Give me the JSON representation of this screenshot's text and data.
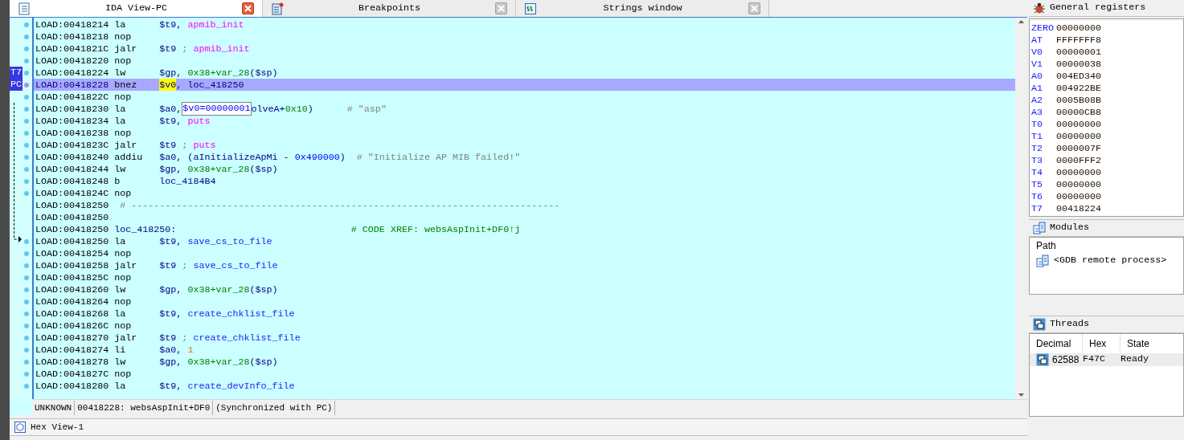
{
  "tabs": [
    {
      "label": "IDA View-PC",
      "selected": true,
      "kind": "disasm"
    },
    {
      "label": "Breakpoints",
      "selected": false,
      "kind": "breakpoints"
    },
    {
      "label": "Strings window",
      "selected": false,
      "kind": "strings"
    }
  ],
  "disassembly": {
    "lines": [
      {
        "address": "LOAD:00418214",
        "mnemonic": "la",
        "dot": true,
        "selected": false,
        "segments": [
          {
            "text": "$t9, ",
            "kind": "plain"
          },
          {
            "text": "apmib_init",
            "kind": "import"
          }
        ]
      },
      {
        "address": "LOAD:00418218",
        "mnemonic": "nop",
        "dot": true,
        "selected": false
      },
      {
        "address": "LOAD:0041821C",
        "mnemonic": "jalr",
        "dot": true,
        "selected": false,
        "segments": [
          {
            "text": "$t9 ",
            "kind": "plain"
          },
          {
            "text": "; ",
            "kind": "comment"
          },
          {
            "text": "apmib_init",
            "kind": "import"
          }
        ]
      },
      {
        "address": "LOAD:00418220",
        "mnemonic": "nop",
        "dot": true,
        "selected": false
      },
      {
        "address": "LOAD:00418224",
        "mnemonic": "lw",
        "dot": true,
        "selected": false,
        "gutter_label": "T7",
        "segments": [
          {
            "text": "$gp, ",
            "kind": "plain"
          },
          {
            "text": "0x38+var_28",
            "kind": "number"
          },
          {
            "text": "($sp)",
            "kind": "plain"
          }
        ]
      },
      {
        "address": "LOAD:00418228",
        "mnemonic": "bnez",
        "dot": true,
        "selected": true,
        "gutter_label": "PC",
        "segments": [
          {
            "text": "$v0",
            "kind": "highlight"
          },
          {
            "text": ", loc_418250",
            "kind": "plain"
          }
        ]
      },
      {
        "address": "LOAD:0041822C",
        "mnemonic": "nop",
        "dot": true,
        "selected": false
      },
      {
        "address": "LOAD:00418230",
        "mnemonic": "la",
        "dot": true,
        "selected": false,
        "segments": [
          {
            "text": "$a0,",
            "kind": "plain"
          },
          {
            "text": "$v0=00000001",
            "kind": "tooltip"
          },
          {
            "text": "olveA+",
            "kind": "plain"
          },
          {
            "text": "0x10",
            "kind": "number"
          },
          {
            "text": ")      ",
            "kind": "plain"
          },
          {
            "text": "# \"asp\"",
            "kind": "comment"
          }
        ]
      },
      {
        "address": "LOAD:00418234",
        "mnemonic": "la",
        "dot": true,
        "selected": false,
        "segments": [
          {
            "text": "$t9, ",
            "kind": "plain"
          },
          {
            "text": "puts",
            "kind": "import"
          }
        ]
      },
      {
        "address": "LOAD:00418238",
        "mnemonic": "nop",
        "dot": true,
        "selected": false
      },
      {
        "address": "LOAD:0041823C",
        "mnemonic": "jalr",
        "dot": true,
        "selected": false,
        "segments": [
          {
            "text": "$t9 ",
            "kind": "plain"
          },
          {
            "text": "; ",
            "kind": "comment"
          },
          {
            "text": "puts",
            "kind": "import"
          }
        ]
      },
      {
        "address": "LOAD:00418240",
        "mnemonic": "addiu",
        "dot": true,
        "selected": false,
        "segments": [
          {
            "text": "$a0, (aInitializeApMi - ",
            "kind": "plain"
          },
          {
            "text": "0x490000",
            "kind": "hex"
          },
          {
            "text": ")  ",
            "kind": "plain"
          },
          {
            "text": "# \"Initialize AP MIB failed!\"",
            "kind": "comment"
          }
        ]
      },
      {
        "address": "LOAD:00418244",
        "mnemonic": "lw",
        "dot": true,
        "selected": false,
        "segments": [
          {
            "text": "$gp, ",
            "kind": "plain"
          },
          {
            "text": "0x38+var_28",
            "kind": "number"
          },
          {
            "text": "($sp)",
            "kind": "plain"
          }
        ]
      },
      {
        "address": "LOAD:00418248",
        "mnemonic": "b",
        "dot": true,
        "selected": false,
        "segments": [
          {
            "text": "loc_4184B4",
            "kind": "plain"
          }
        ]
      },
      {
        "address": "LOAD:0041824C",
        "mnemonic": "nop",
        "dot": true,
        "selected": false
      },
      {
        "address": "LOAD:00418250",
        "dot": false,
        "selected": false,
        "segments": [
          {
            "text": " # ----------------------------------------------------------------------------",
            "kind": "comment"
          }
        ]
      },
      {
        "address": "LOAD:00418250",
        "dot": false,
        "selected": false
      },
      {
        "address": "LOAD:00418250",
        "dot": false,
        "selected": false,
        "segments": [
          {
            "text": "loc_418250:                               ",
            "kind": "plain"
          },
          {
            "text": "# CODE XREF: websAspInit+DF0↑j",
            "kind": "xref"
          }
        ]
      },
      {
        "address": "LOAD:00418250",
        "mnemonic": "la",
        "dot": true,
        "selected": false,
        "segments": [
          {
            "text": "$t9, ",
            "kind": "plain"
          },
          {
            "text": "save_cs_to_file",
            "kind": "function"
          }
        ]
      },
      {
        "address": "LOAD:00418254",
        "mnemonic": "nop",
        "dot": true,
        "selected": false
      },
      {
        "address": "LOAD:00418258",
        "mnemonic": "jalr",
        "dot": true,
        "selected": false,
        "segments": [
          {
            "text": "$t9 ",
            "kind": "plain"
          },
          {
            "text": "; ",
            "kind": "comment"
          },
          {
            "text": "save_cs_to_file",
            "kind": "function"
          }
        ]
      },
      {
        "address": "LOAD:0041825C",
        "mnemonic": "nop",
        "dot": true,
        "selected": false
      },
      {
        "address": "LOAD:00418260",
        "mnemonic": "lw",
        "dot": true,
        "selected": false,
        "segments": [
          {
            "text": "$gp, ",
            "kind": "plain"
          },
          {
            "text": "0x38+var_28",
            "kind": "number"
          },
          {
            "text": "($sp)",
            "kind": "plain"
          }
        ]
      },
      {
        "address": "LOAD:00418264",
        "mnemonic": "nop",
        "dot": true,
        "selected": false
      },
      {
        "address": "LOAD:00418268",
        "mnemonic": "la",
        "dot": true,
        "selected": false,
        "segments": [
          {
            "text": "$t9, ",
            "kind": "plain"
          },
          {
            "text": "create_chklist_file",
            "kind": "function"
          }
        ]
      },
      {
        "address": "LOAD:0041826C",
        "mnemonic": "nop",
        "dot": true,
        "selected": false
      },
      {
        "address": "LOAD:00418270",
        "mnemonic": "jalr",
        "dot": true,
        "selected": false,
        "segments": [
          {
            "text": "$t9 ",
            "kind": "plain"
          },
          {
            "text": "; ",
            "kind": "comment"
          },
          {
            "text": "create_chklist_file",
            "kind": "function"
          }
        ]
      },
      {
        "address": "LOAD:00418274",
        "mnemonic": "li",
        "dot": true,
        "selected": false,
        "segments": [
          {
            "text": "$a0, ",
            "kind": "plain"
          },
          {
            "text": "1",
            "kind": "immediate"
          }
        ]
      },
      {
        "address": "LOAD:00418278",
        "mnemonic": "lw",
        "dot": true,
        "selected": false,
        "segments": [
          {
            "text": "$gp, ",
            "kind": "plain"
          },
          {
            "text": "0x38+var_28",
            "kind": "number"
          },
          {
            "text": "($sp)",
            "kind": "plain"
          }
        ]
      },
      {
        "address": "LOAD:0041827C",
        "mnemonic": "nop",
        "dot": true,
        "selected": false
      },
      {
        "address": "LOAD:00418280",
        "mnemonic": "la",
        "dot": true,
        "selected": false,
        "segments": [
          {
            "text": "$t9, ",
            "kind": "plain"
          },
          {
            "text": "create_devInfo_file",
            "kind": "function"
          }
        ]
      }
    ],
    "status_bar": [
      "UNKNOWN",
      "00418228: websAspInit+DF0",
      "(Synchronized with PC)"
    ]
  },
  "bottom_tab": {
    "label": "Hex View-1"
  },
  "registers": {
    "title": "General registers",
    "rows": [
      {
        "name": "ZERO",
        "value": "00000000"
      },
      {
        "name": "AT",
        "value": "FFFFFFF8"
      },
      {
        "name": "V0",
        "value": "00000001"
      },
      {
        "name": "V1",
        "value": "00000038"
      },
      {
        "name": "A0",
        "value": "004ED340"
      },
      {
        "name": "A1",
        "value": "004922BE"
      },
      {
        "name": "A2",
        "value": "0005B08B"
      },
      {
        "name": "A3",
        "value": "00000CB8"
      },
      {
        "name": "T0",
        "value": "00000000"
      },
      {
        "name": "T1",
        "value": "00000000"
      },
      {
        "name": "T2",
        "value": "0000007F"
      },
      {
        "name": "T3",
        "value": "0000FFF2"
      },
      {
        "name": "T4",
        "value": "00000000"
      },
      {
        "name": "T5",
        "value": "00000000"
      },
      {
        "name": "T6",
        "value": "00000000"
      },
      {
        "name": "T7",
        "value": "00418224"
      }
    ]
  },
  "modules": {
    "title": "Modules",
    "columns": [
      "Path"
    ],
    "rows": [
      "<GDB remote process>"
    ]
  },
  "threads": {
    "title": "Threads",
    "columns": [
      "Decimal",
      "Hex",
      "State"
    ],
    "rows": [
      {
        "decimal": "62588",
        "hex": "F47C",
        "state": "Ready",
        "selected": true
      }
    ]
  }
}
